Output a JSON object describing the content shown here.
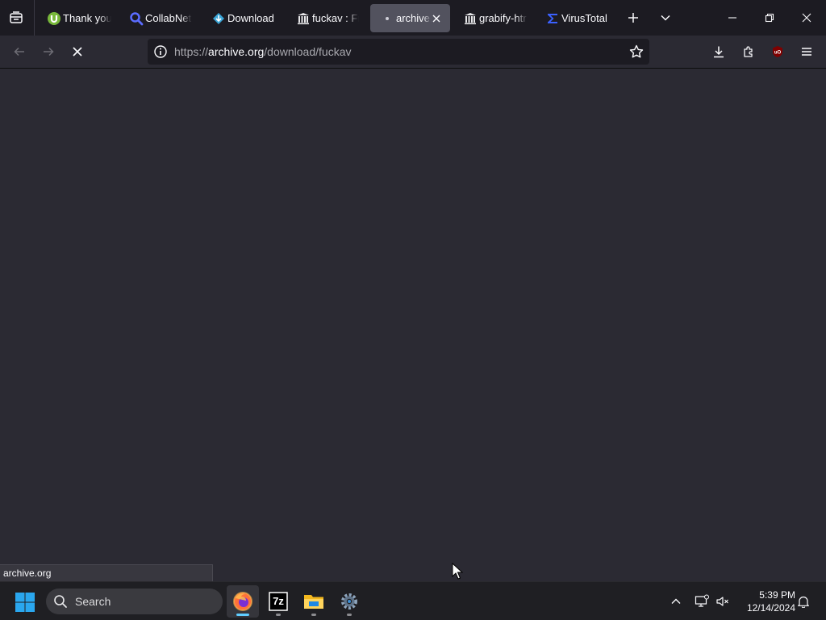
{
  "browser": {
    "tabs": [
      {
        "title": "Thank you",
        "icon": "utorrent-icon"
      },
      {
        "title": "CollabNet",
        "icon": "collabnet-icon"
      },
      {
        "title": "Download",
        "icon": "download-site-icon"
      },
      {
        "title": "fuckav : Fr",
        "icon": "archive-icon"
      },
      {
        "title": "archive.",
        "icon": "loading-dot-icon",
        "active": true
      },
      {
        "title": "grabify-htr",
        "icon": "archive-icon"
      },
      {
        "title": "VirusTotal",
        "icon": "virustotal-icon"
      }
    ],
    "address": {
      "scheme": "https://",
      "host": "archive.org",
      "path": "/download/fuckav"
    },
    "status_text": "archive.org"
  },
  "taskbar": {
    "search_label": "Search",
    "apps": [
      {
        "name": "Firefox",
        "icon": "firefox-icon",
        "active": true
      },
      {
        "name": "7-Zip",
        "icon": "7zip-icon",
        "label": "7z"
      },
      {
        "name": "File Explorer",
        "icon": "folder-icon"
      },
      {
        "name": "Settings",
        "icon": "settings-gear-icon"
      }
    ],
    "time": "5:39 PM",
    "date": "12/14/2024"
  },
  "colors": {
    "tabbar_bg": "#1c1b22",
    "content_bg": "#2b2a33",
    "active_tab_bg": "#52525e",
    "taskbar_bg": "#1f1f23",
    "accent": "#60cdff"
  }
}
